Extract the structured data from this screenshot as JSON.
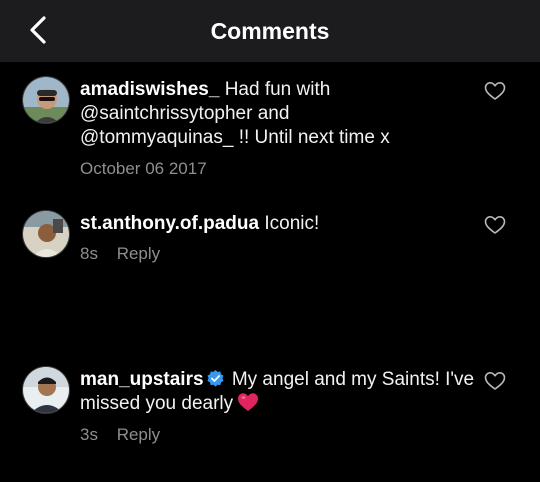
{
  "header": {
    "title": "Comments",
    "back_icon": "chevron-left-icon"
  },
  "comments": [
    {
      "username": "amadiswishes_",
      "text_parts": [
        "Had fun with",
        "@saintchrissytopher",
        "and",
        "@tommyaquinas_",
        "!! Until next time x"
      ],
      "timestamp": "October 06 2017",
      "reply_label": "",
      "verified": false
    },
    {
      "username": "st.anthony.of.padua",
      "text": "Iconic!",
      "timestamp": "8s",
      "reply_label": "Reply",
      "verified": false
    },
    {
      "username": "man_upstairs",
      "text": "My angel and my Saints! I've missed you dearly",
      "emoji": "red-heart-emoji",
      "timestamp": "3s",
      "reply_label": "Reply",
      "verified": true
    }
  ],
  "colors": {
    "background": "#000000",
    "header_background": "#1c1c1e",
    "meta_text": "#8e8e93",
    "verified_badge": "#3897f0",
    "heart": "#e0245e"
  }
}
